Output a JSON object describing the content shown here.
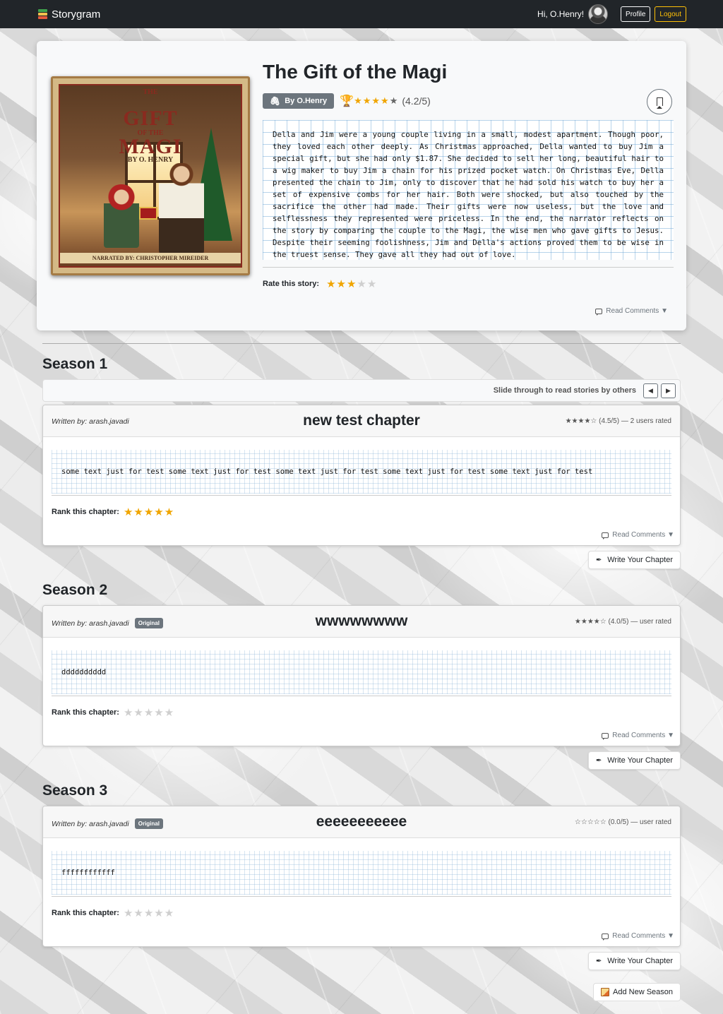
{
  "navbar": {
    "brand": "Storygram",
    "greeting": "Hi, O.Henry!",
    "profile_label": "Profile",
    "logout_label": "Logout"
  },
  "story": {
    "title": "The Gift of the Magi",
    "author_badge": "By O.Henry",
    "rating_stars": "★★★★",
    "rating_star_empty": "★",
    "rating_text": "(4.2/5)",
    "cover": {
      "line1": "THE",
      "line2": "GIFT",
      "line3": "OF THE",
      "line4": "MAGI",
      "author": "BY O. HENRY",
      "narrated": "NARRATED BY: CHRISTOPHER MIREIDER"
    },
    "summary": "Della and Jim were a young couple living in a small, modest apartment. Though poor, they loved each other deeply. As Christmas approached, Della wanted to buy Jim a special gift, but she had only $1.87. She decided to sell her long, beautiful hair to a wig maker to buy Jim a chain for his prized pocket watch. On Christmas Eve, Della presented the chain to Jim, only to discover that he had sold his watch to buy her a set of expensive combs for her hair. Both were shocked, but also touched by the sacrifice the other had made. Their gifts were now useless, but the love and selflessness they represented were priceless. In the end, the narrator reflects on the story by comparing the couple to the Magi, the wise men who gave gifts to Jesus. Despite their seeming foolishness, Jim and Della's actions proved them to be wise in the truest sense. They gave all they had out of love.",
    "rate_label": "Rate this story:",
    "user_rating": 3,
    "user_rating_on": "★★★",
    "user_rating_off": "★★",
    "comments_label": "Read Comments ▼"
  },
  "slider": {
    "text": "Slide through to read stories by others",
    "prev": "◀",
    "next": "▶"
  },
  "seasons": [
    {
      "title": "Season 1",
      "chapter": {
        "written_by_label": "Written by:",
        "author": "arash.javadi",
        "badge": "",
        "title": "new test chapter",
        "rating": "★★★★☆ (4.5/5) — 2 users rated",
        "body": "some text just for test some text just for test some text just for test some text just for test some text just for test",
        "rank_label": "Rank this chapter:",
        "rank_on": "★★★★★",
        "rank_off": "",
        "comments_label": "Read Comments ▼"
      },
      "write_label": "Write Your Chapter"
    },
    {
      "title": "Season 2",
      "chapter": {
        "written_by_label": "Written by:",
        "author": "arash.javadi",
        "badge": "Original",
        "title": "wwwwwwww",
        "rating": "★★★★☆ (4.0/5) — user rated",
        "body": "dddddddddd",
        "rank_label": "Rank this chapter:",
        "rank_on": "",
        "rank_off": "★★★★★",
        "comments_label": "Read Comments ▼"
      },
      "write_label": "Write Your Chapter"
    },
    {
      "title": "Season 3",
      "chapter": {
        "written_by_label": "Written by:",
        "author": "arash.javadi",
        "badge": "Original",
        "title": "eeeeeeeeeee",
        "rating": "☆☆☆☆☆ (0.0/5) — user rated",
        "body": "ffffffffffff",
        "rank_label": "Rank this chapter:",
        "rank_on": "",
        "rank_off": "★★★★★",
        "comments_label": "Read Comments ▼"
      },
      "write_label": "Write Your Chapter"
    }
  ],
  "add_season_label": "Add New Season",
  "colors": {
    "navbar": "#212529",
    "star": "#f0a500",
    "logout": "#ffc107",
    "badge": "#6c757d"
  }
}
